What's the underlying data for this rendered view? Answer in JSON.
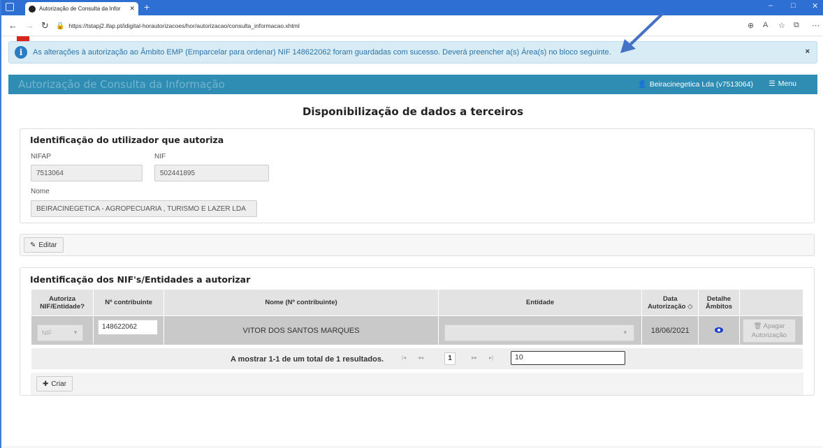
{
  "browser": {
    "tab_title": "Autorização de Consulta da Infor",
    "tab_close": "✕",
    "new_tab": "+",
    "url": "https://tstapj2.ifap.pt/idigital-horautorizacoes/hor/autorizacao/consulta_informacao.xhtml",
    "controls": {
      "minimize": "–",
      "maximize": "□",
      "close": "✕"
    }
  },
  "alert": {
    "message": "As alterações à autorização ao Âmbito EMP (Emparcelar para ordenar) NIF 148622062 foram guardadas com sucesso. Deverá preencher a(s) Área(s) no bloco seguinte.",
    "info_icon": "i",
    "close": "×"
  },
  "appbar": {
    "title": "Autorização de Consulta da Informação",
    "user": "Beiracinegetica Lda (v7513064)",
    "menu": "Menu"
  },
  "page_title": "Disponibilização de dados a terceiros",
  "user_panel": {
    "heading": "Identificação do utilizador que autoriza",
    "nifap_label": "NIFAP",
    "nifap_value": "7513064",
    "nif_label": "NIF",
    "nif_value": "502441895",
    "nome_label": "Nome",
    "nome_value": "BEIRACINEGETICA - AGROPECUARIA , TURISMO E LAZER LDA"
  },
  "edit_button": "Editar",
  "nif_panel": {
    "heading": "Identificação dos NIF's/Entidades a autorizar",
    "columns": [
      "Autoriza NIF/Entidade?",
      "Nº contribuinte",
      "Nome (Nº contribuinte)",
      "Entidade",
      "Data Autorização ◇",
      "Detalhe Âmbitos",
      ""
    ],
    "col_autoriza_1": "Autoriza",
    "col_autoriza_2": "NIF/Entidade?",
    "col_data_1": "Data",
    "col_data_2": "Autorização ◇",
    "col_detalhe_1": "Detalhe",
    "col_detalhe_2": "Âmbitos",
    "row": {
      "autoriza": "NIF",
      "contribuinte": "148622062",
      "nome": "VITOR DOS SANTOS MARQUES",
      "entidade": "",
      "data": "18/06/2021",
      "apagar_1": "Apagar",
      "apagar_2": "Autorização"
    },
    "paginator_text": "A mostrar 1-1 de um total de 1 resultados.",
    "page_first": "|◂",
    "page_prev": "◂◂",
    "current_page": "1",
    "page_next": "▸▸",
    "page_last": "▸|",
    "rows_per_page": "10",
    "criar_button": "Criar"
  }
}
